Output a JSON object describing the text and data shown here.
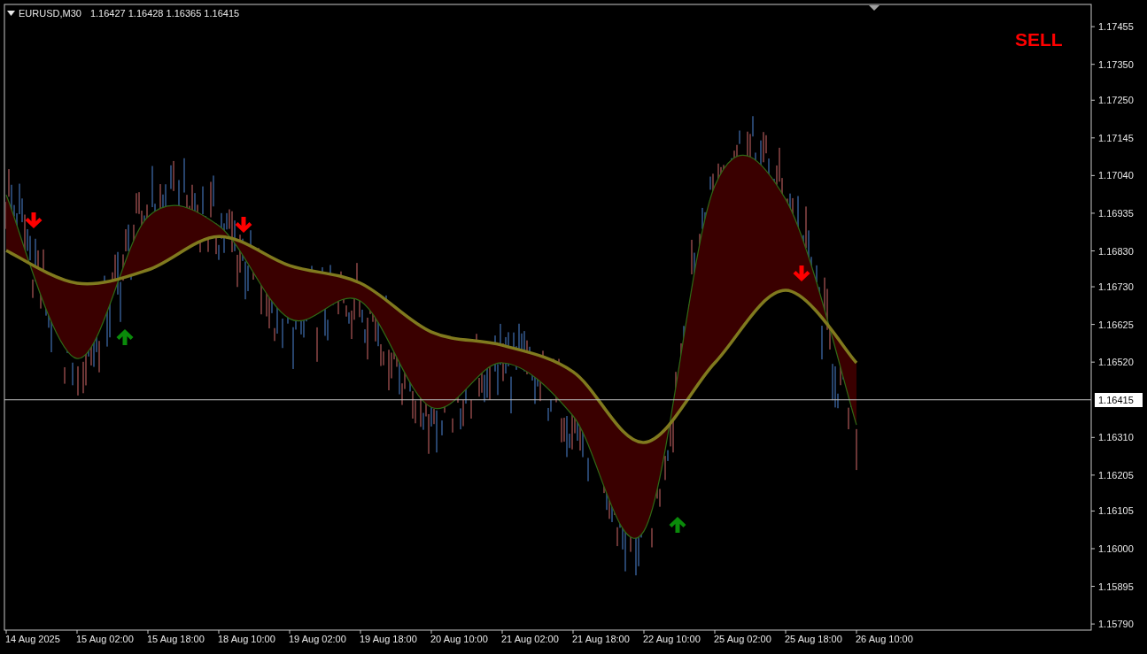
{
  "header": {
    "symbol": "EURUSD,M30",
    "quote": "1.16427 1.16428 1.16365 1.16415"
  },
  "signal": {
    "label": "SELL"
  },
  "chart_data": {
    "type": "line",
    "categories": [
      "14 Aug 2025",
      "15 Aug 02:00",
      "15 Aug 18:00",
      "18 Aug 10:00",
      "19 Aug 02:00",
      "19 Aug 18:00",
      "20 Aug 10:00",
      "21 Aug 02:00",
      "21 Aug 18:00",
      "22 Aug 10:00",
      "25 Aug 02:00",
      "25 Aug 18:00",
      "26 Aug 10:00"
    ],
    "series": [
      {
        "color": "#2f6a16",
        "values": [
          1.16986,
          1.1653,
          1.16925,
          1.169,
          1.16641,
          1.1669,
          1.16394,
          1.16518,
          1.1637,
          1.16049,
          1.17011,
          1.16974,
          1.16345
        ]
      },
      {
        "color": "#807a1e",
        "values": [
          1.16831,
          1.1674,
          1.16777,
          1.1687,
          1.16789,
          1.1674,
          1.16604,
          1.16567,
          1.16493,
          1.16296,
          1.16518,
          1.1672,
          1.16518
        ]
      }
    ],
    "ylim": [
      1.15773,
      1.17517
    ],
    "yticks": [
      {
        "value": 1.17455,
        "label": "1.17455"
      },
      {
        "value": 1.1735,
        "label": "1.17350"
      },
      {
        "value": 1.1725,
        "label": "1.17250"
      },
      {
        "value": 1.17145,
        "label": "1.17145"
      },
      {
        "value": 1.1704,
        "label": "1.17040"
      },
      {
        "value": 1.16935,
        "label": "1.16935"
      },
      {
        "value": 1.1683,
        "label": "1.16830"
      },
      {
        "value": 1.1673,
        "label": "1.16730"
      },
      {
        "value": 1.16625,
        "label": "1.16625"
      },
      {
        "value": 1.1652,
        "label": "1.16520"
      },
      {
        "value": 1.1631,
        "label": "1.16310"
      },
      {
        "value": 1.16205,
        "label": "1.16205"
      },
      {
        "value": 1.16105,
        "label": "1.16105"
      },
      {
        "value": 1.16,
        "label": "1.16000"
      },
      {
        "value": 1.15895,
        "label": "1.15895"
      },
      {
        "value": 1.1579,
        "label": "1.15790"
      }
    ],
    "ref_lines": [
      {
        "axis": "y",
        "value": 1.16415,
        "label": "1.16415"
      }
    ]
  }
}
